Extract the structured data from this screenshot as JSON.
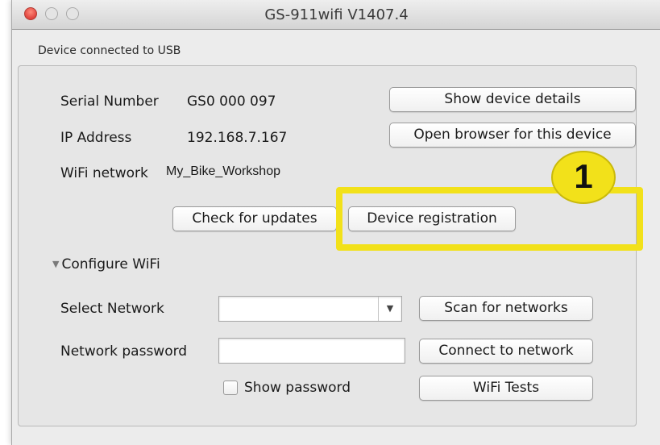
{
  "window": {
    "title": "GS-911wifi V1407.4",
    "status": "Device connected to USB"
  },
  "device": {
    "serial_label": "Serial Number",
    "serial_value": "GS0 000 097",
    "ip_label": "IP Address",
    "ip_value": "192.168.7.167",
    "wifi_label": "WiFi network",
    "wifi_value": "My_Bike_Workshop",
    "show_details_button": "Show device details",
    "open_browser_button": "Open browser for this device",
    "check_updates_button": "Check for updates",
    "registration_button": "Device registration"
  },
  "configure": {
    "section_label": "Configure WiFi",
    "select_network_label": "Select Network",
    "select_network_value": "",
    "scan_button": "Scan for networks",
    "password_label": "Network password",
    "password_value": "",
    "connect_button": "Connect to network",
    "show_password_label": "Show password",
    "show_password_checked": false,
    "wifi_tests_button": "WiFi Tests"
  },
  "annotation": {
    "badge_number": "1",
    "highlight_color": "#f2e11a"
  },
  "icons": {
    "dropdown": "chevron-down-icon",
    "disclosure": "disclosure-triangle-icon"
  }
}
